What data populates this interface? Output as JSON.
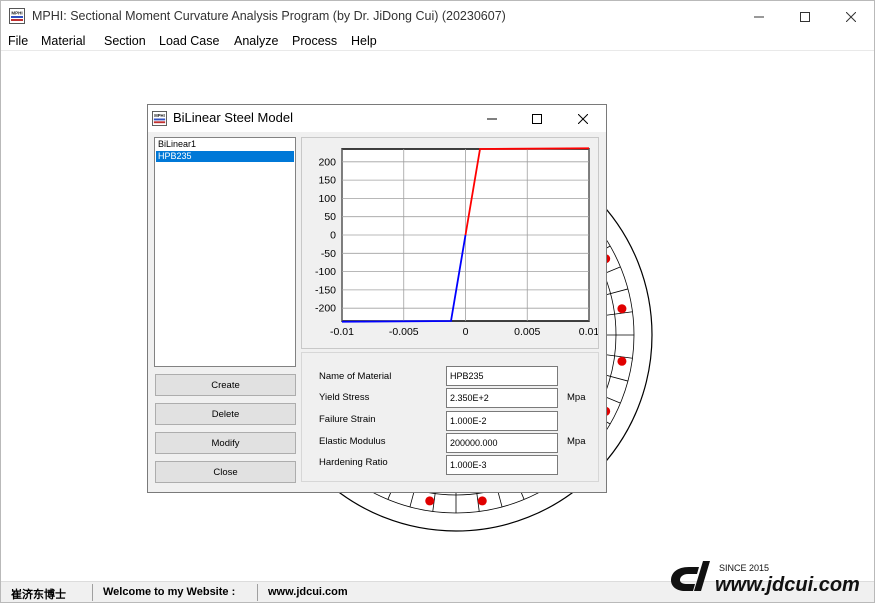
{
  "app": {
    "title": "MPHI: Sectional Moment Curvature Analysis Program (by Dr. JiDong Cui) (20230607)",
    "icon_text": "MPHI",
    "window_controls": {
      "minimize": "—",
      "maximize": "☐",
      "close": "✕"
    }
  },
  "menu": [
    {
      "label": "File"
    },
    {
      "label": "Material"
    },
    {
      "label": "Section"
    },
    {
      "label": "Load Case"
    },
    {
      "label": "Analyze"
    },
    {
      "label": "Process"
    },
    {
      "label": "Help"
    }
  ],
  "dialog": {
    "title": "BiLinear Steel Model",
    "icon_text": "MPHI",
    "controls": {
      "minimize": "—",
      "maximize": "☐",
      "close": "✕"
    },
    "materials": [
      {
        "name": "BiLinear1",
        "selected": false
      },
      {
        "name": "HPB235",
        "selected": true
      }
    ],
    "buttons": {
      "create": "Create",
      "delete": "Delete",
      "modify": "Modify",
      "close": "Close"
    },
    "properties": {
      "name_label": "Name of Material",
      "name_value": "HPB235",
      "yield_label": "Yield Stress",
      "yield_value": "2.350E+2",
      "yield_unit": "Mpa",
      "failure_label": "Failure Strain",
      "failure_value": "1.000E-2",
      "modulus_label": "Elastic Modulus",
      "modulus_value": "200000.000",
      "modulus_unit": "Mpa",
      "hardening_label": "Hardening Ratio",
      "hardening_value": "1.000E-3"
    }
  },
  "chart_data": {
    "type": "line",
    "title": "",
    "xlabel": "",
    "ylabel": "",
    "xlim": [
      -0.01,
      0.01
    ],
    "ylim": [
      -235,
      235
    ],
    "x_ticks": [
      -0.01,
      -0.005,
      0,
      0.005,
      0.01
    ],
    "x_tick_labels": [
      "-0.01",
      "-0.005",
      "0",
      "0.005",
      "0.01"
    ],
    "y_ticks": [
      -200,
      -150,
      -100,
      -50,
      0,
      50,
      100,
      150,
      200
    ],
    "y_tick_labels": [
      "-200",
      "-150",
      "-100",
      "-50",
      "0",
      "50",
      "100",
      "150",
      "200"
    ],
    "grid": true,
    "series": [
      {
        "color": "#0000ff",
        "x": [
          -0.01,
          -0.001175,
          0
        ],
        "y": [
          -237,
          -235,
          0
        ]
      },
      {
        "color": "#ff0000",
        "x": [
          0,
          0.001175,
          0.01
        ],
        "y": [
          0,
          235,
          237
        ]
      }
    ]
  },
  "statusbar": {
    "name": "崔济东博士",
    "welcome": "Welcome to my Website :",
    "url": "www.jdcui.com"
  },
  "watermark": {
    "since": "SINCE 2015",
    "site": "www.jdcui.com"
  },
  "colors": {
    "selection": "#0078d7",
    "positive_branch": "#ff0000",
    "negative_branch": "#0000ff",
    "rebar_dot": "#e00000"
  }
}
